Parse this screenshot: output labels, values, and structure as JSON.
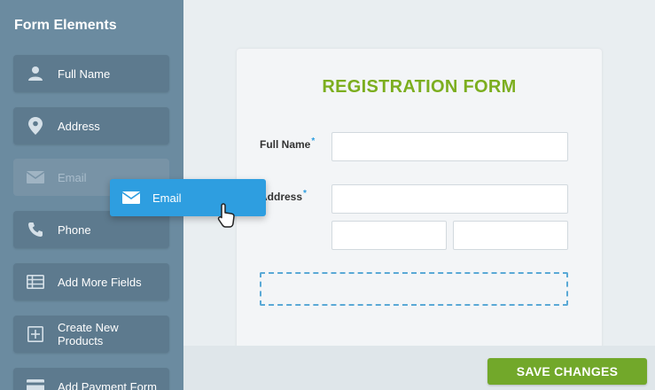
{
  "sidebar": {
    "title": "Form Elements",
    "items": [
      {
        "label": "Full Name",
        "icon": "person-icon"
      },
      {
        "label": "Address",
        "icon": "map-pin-icon"
      },
      {
        "label": "Email",
        "icon": "envelope-icon"
      },
      {
        "label": "Phone",
        "icon": "phone-icon"
      },
      {
        "label": "Add More Fields",
        "icon": "fields-icon"
      },
      {
        "label": "Create New Products",
        "icon": "plus-square-icon"
      },
      {
        "label": "Add Payment Form",
        "icon": "card-icon"
      }
    ]
  },
  "drag": {
    "label": "Email",
    "icon": "envelope-icon"
  },
  "form": {
    "title": "REGISTRATION FORM",
    "fields": [
      {
        "label": "Full Name",
        "required_mark": "*"
      },
      {
        "label": "Address",
        "required_mark": "*"
      }
    ]
  },
  "footer": {
    "save_label": "SAVE CHANGES"
  },
  "colors": {
    "sidebar": "#6b8ba0",
    "item": "#5d7a8e",
    "accent_blue": "#2e9ee0",
    "brand_green": "#7cae1f",
    "button_green": "#72a82a"
  }
}
